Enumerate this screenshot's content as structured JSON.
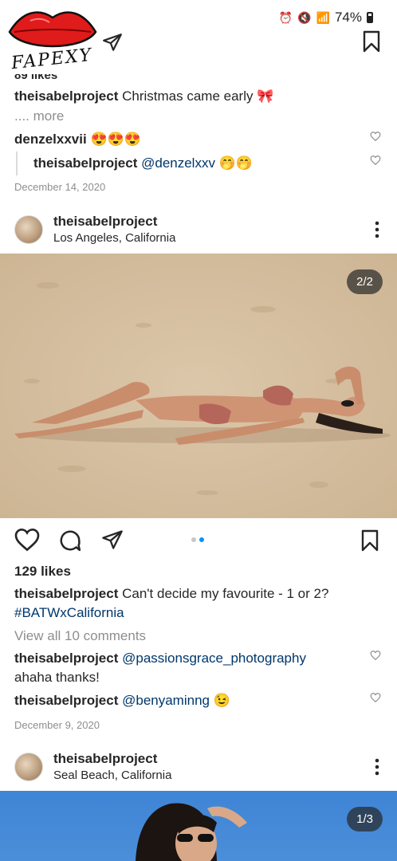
{
  "status_bar": {
    "battery": "74%"
  },
  "watermark": {
    "text": "FAPEXY"
  },
  "post1": {
    "likes_partial": "89 likes",
    "caption_user": "theisabelproject",
    "caption_text": "Christmas came early 🎀",
    "more": ".... more",
    "comments": [
      {
        "user": "denzelxxvii",
        "text": "😍😍😍"
      },
      {
        "user": "theisabelproject",
        "text": "@denzelxxv 🤭🤭"
      }
    ],
    "date": "December 14, 2020"
  },
  "post2": {
    "user": "theisabelproject",
    "location": "Los Angeles, California",
    "image_counter": "2/2",
    "likes": "129 likes",
    "caption_user": "theisabelproject",
    "caption_text": "Can't decide my favourite - 1 or 2?",
    "hashtag": "#BATWxCalifornia",
    "view_comments": "View all 10 comments",
    "comments": [
      {
        "user": "theisabelproject",
        "mention": "@passionsgrace_photography",
        "text": "ahaha thanks!"
      },
      {
        "user": "theisabelproject",
        "mention": "@benyaminng",
        "text": "😉"
      }
    ],
    "date": "December 9, 2020"
  },
  "post3": {
    "user": "theisabelproject",
    "location": "Seal Beach, California",
    "image_counter": "1/3"
  },
  "colors": {
    "link": "#00376b",
    "dot_active": "#0095f6",
    "sand": "#d8c2a4",
    "sky": "#3a7fd0"
  }
}
